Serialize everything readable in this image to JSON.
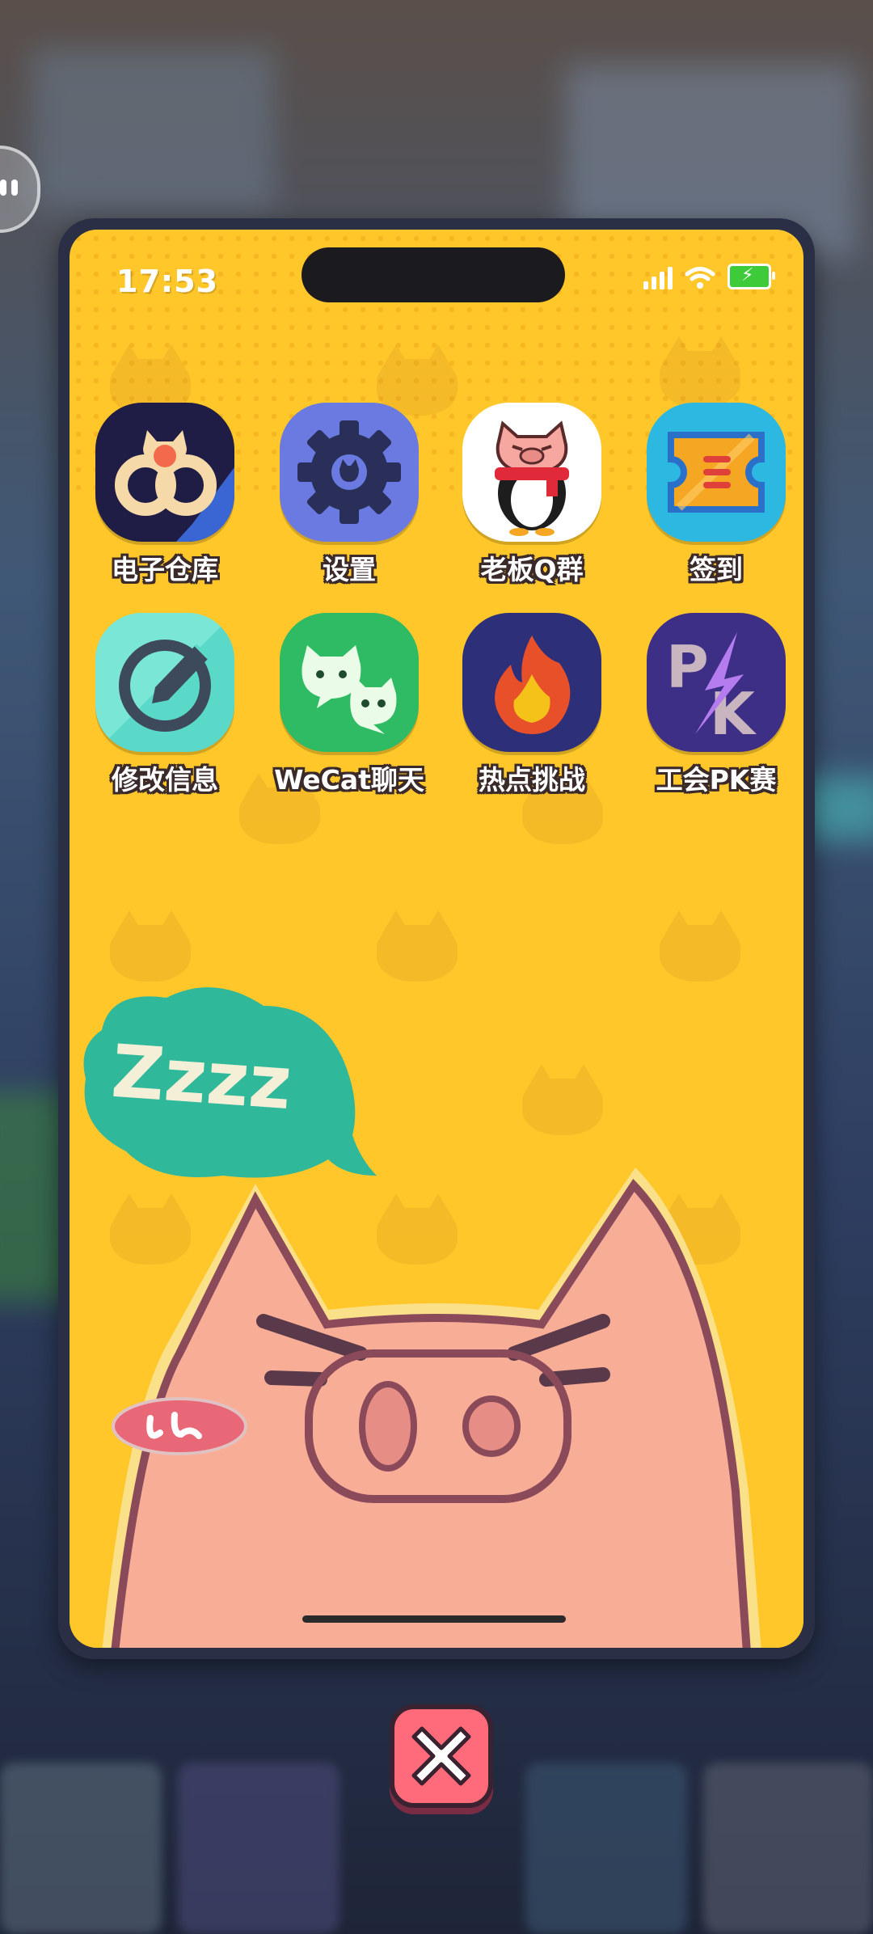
{
  "status_bar": {
    "time": "17:53"
  },
  "apps": [
    {
      "label": "电子仓库",
      "icon": "infinity-cat-icon"
    },
    {
      "label": "设置",
      "icon": "gear-icon"
    },
    {
      "label": "老板Q群",
      "icon": "penguin-pig-icon"
    },
    {
      "label": "签到",
      "icon": "ticket-icon"
    },
    {
      "label": "修改信息",
      "icon": "edit-pencil-icon"
    },
    {
      "label": "WeCat聊天",
      "icon": "chat-cats-icon"
    },
    {
      "label": "热点挑战",
      "icon": "flame-icon"
    },
    {
      "label": "工会PK赛",
      "icon": "pk-icon"
    }
  ],
  "wallpaper": {
    "sleep_text": "Zzzz"
  },
  "colors": {
    "screen_bg": "#ffc72a",
    "close_button": "#ff6b7a",
    "frame": "#2b2f45"
  }
}
